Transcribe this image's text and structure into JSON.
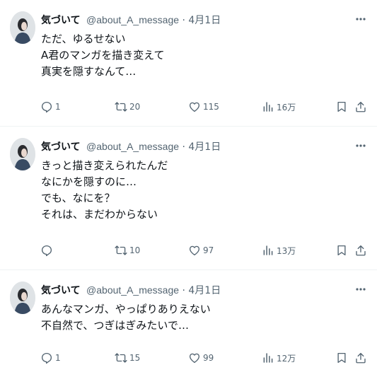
{
  "tweets": [
    {
      "author": "気づいて",
      "handle": "@about_A_message",
      "dot": "·",
      "date": "4月1日",
      "lines": [
        "ただ、ゆるせない",
        "A君のマンガを描き変えて",
        "真実を隠すなんて…"
      ],
      "replies": "1",
      "retweets": "20",
      "likes": "115",
      "views": "16万"
    },
    {
      "author": "気づいて",
      "handle": "@about_A_message",
      "dot": "·",
      "date": "4月1日",
      "lines": [
        "きっと描き変えられたんだ",
        "なにかを隠すのに…",
        "でも、なにを？",
        "それは、まだわからない"
      ],
      "replies": "",
      "retweets": "10",
      "likes": "97",
      "views": "13万"
    },
    {
      "author": "気づいて",
      "handle": "@about_A_message",
      "dot": "·",
      "date": "4月1日",
      "lines": [
        "あんなマンガ、やっぱりありえない",
        "不自然で、つぎはぎみたいで…"
      ],
      "replies": "1",
      "retweets": "15",
      "likes": "99",
      "views": "12万"
    }
  ],
  "colors": {
    "text": "#0f1419",
    "secondary": "#536471",
    "divider": "#eff3f4"
  }
}
